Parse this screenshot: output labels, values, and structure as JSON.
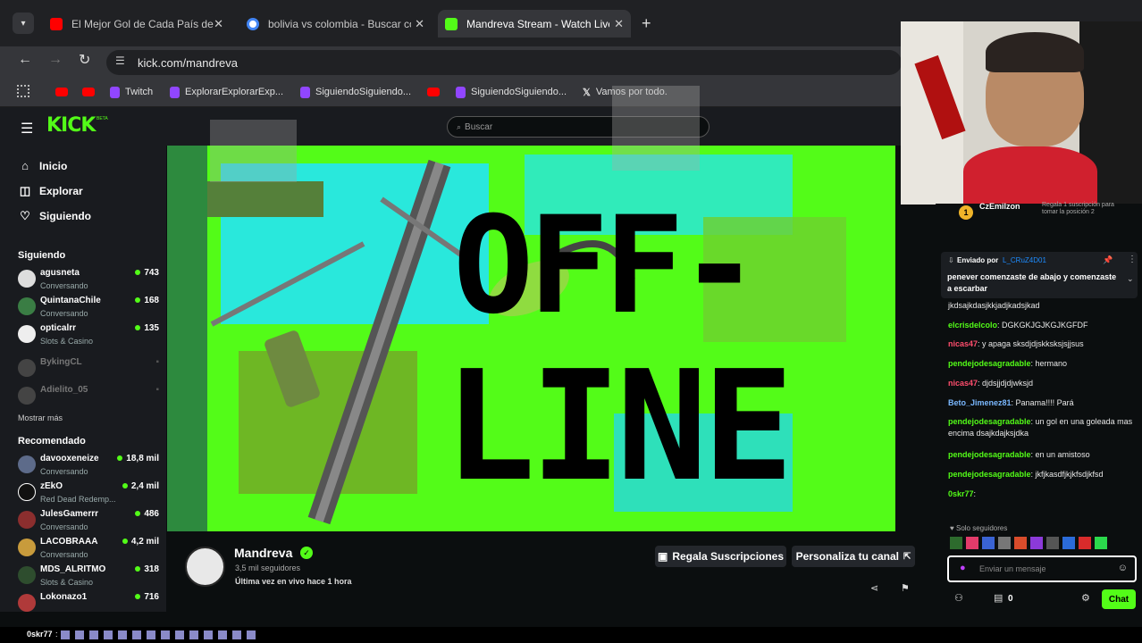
{
  "tabs": [
    {
      "label": "El Mejor Gol de Cada País de Am",
      "color": "#ff0000"
    },
    {
      "label": "bolivia vs colombia - Buscar con",
      "color": "#4285f4"
    },
    {
      "label": "Mandreva Stream - Watch Live",
      "color": "#53fc18"
    }
  ],
  "address": {
    "url": "kick.com/mandreva"
  },
  "bookmarks": [
    {
      "label": "",
      "color": "#ff0000"
    },
    {
      "label": "",
      "color": "#ff0000"
    },
    {
      "label": "Twitch",
      "color": "#9146ff"
    },
    {
      "label": "ExplorarExplorarExp...",
      "color": "#9146ff"
    },
    {
      "label": "SiguiendoSiguiendo...",
      "color": "#9146ff"
    },
    {
      "label": "",
      "color": "#ff0000"
    },
    {
      "label": "SiguiendoSiguiendo...",
      "color": "#9146ff"
    },
    {
      "label": "Vamos por todo.",
      "color": "#ffffff"
    }
  ],
  "logo": "KICK",
  "logo_badge": "BETA",
  "search": {
    "placeholder": "Buscar"
  },
  "nav": [
    {
      "label": "Inicio",
      "icon": "home-icon"
    },
    {
      "label": "Explorar",
      "icon": "compass-icon"
    },
    {
      "label": "Siguiendo",
      "icon": "heart-icon"
    }
  ],
  "following_title": "Siguiendo",
  "following": [
    {
      "name": "agusneta",
      "sub": "Conversando",
      "viewers": "743",
      "online": true
    },
    {
      "name": "QuintanaChile",
      "sub": "Conversando",
      "viewers": "168",
      "online": true
    },
    {
      "name": "opticalrr",
      "sub": "Slots & Casino",
      "viewers": "135",
      "online": true
    },
    {
      "name": "BykingCL",
      "sub": "",
      "viewers": "",
      "online": false
    },
    {
      "name": "Adielito_05",
      "sub": "",
      "viewers": "",
      "online": false
    }
  ],
  "show_more": "Mostrar más",
  "recommended_title": "Recomendado",
  "recommended": [
    {
      "name": "davooxeneize",
      "sub": "Conversando",
      "viewers": "18,8 mil"
    },
    {
      "name": "zEkO",
      "sub": "Red Dead Redemp...",
      "viewers": "2,4 mil"
    },
    {
      "name": "JulesGamerrr",
      "sub": "Conversando",
      "viewers": "486"
    },
    {
      "name": "LACOBRAAA",
      "sub": "Conversando",
      "viewers": "4,2 mil"
    },
    {
      "name": "MDS_ALRITMO",
      "sub": "Slots & Casino",
      "viewers": "318"
    },
    {
      "name": "Lokonazo1",
      "sub": "",
      "viewers": "716"
    }
  ],
  "offline_text": {
    "line1": "OFF-",
    "line2": "LINE"
  },
  "channel": {
    "name": "Mandreva",
    "followers": "3,5 mil seguidores",
    "last_live": "Última vez en vivo hace 1 hora",
    "gift_button": "Regala Suscripciones",
    "customize_button": "Personaliza tu canal"
  },
  "chat": {
    "top_gifter_name": "CzEmilzon",
    "top_gifter_note": "Regala 1 suscripción para tomar la posición 2",
    "pinned_by_label": "Enviado por",
    "pinned_by_user": "L_CRuZ4D01",
    "pinned_text": "penever comenzaste de abajo y comenzaste a escarbar",
    "messages": [
      {
        "user": "",
        "text": "jkdsajkdasjkkjadjkadsjkad",
        "color": "#ffffff"
      },
      {
        "user": "elcrisdelcolo",
        "text": ": DGKGKJGJKGJKGFDF",
        "color": "#53fc18"
      },
      {
        "user": "nicas47",
        "text": ": y apaga sksdjdjskksksjsjjsus",
        "color": "#ff4d6d"
      },
      {
        "user": "pendejodesagradable",
        "text": ": hermano",
        "color": "#53fc18"
      },
      {
        "user": "nicas47",
        "text": ": djdsjjdjdjwksjd",
        "color": "#ff4d6d"
      },
      {
        "user": "Beto_Jimenez81",
        "text": ": Panama!!!! Pará",
        "color": "#7ab8ff"
      },
      {
        "user": "pendejodesagradable",
        "text": ": un gol en una goleada mas encima dsajkdajksjdka",
        "color": "#53fc18"
      },
      {
        "user": "pendejodesagradable",
        "text": ": en un amistoso",
        "color": "#53fc18"
      },
      {
        "user": "pendejodesagradable",
        "text": ": jkfjkasdfjkjkfsdjkfsd",
        "color": "#53fc18"
      },
      {
        "user": "0skr77",
        "text": ":",
        "color": "#53fc18"
      }
    ],
    "followers_only": "Solo seguidores",
    "input_placeholder": "Enviar un mensaje",
    "points": "0",
    "chat_button": "Chat"
  },
  "ticker": {
    "user": "0skr77",
    "text": ":"
  }
}
